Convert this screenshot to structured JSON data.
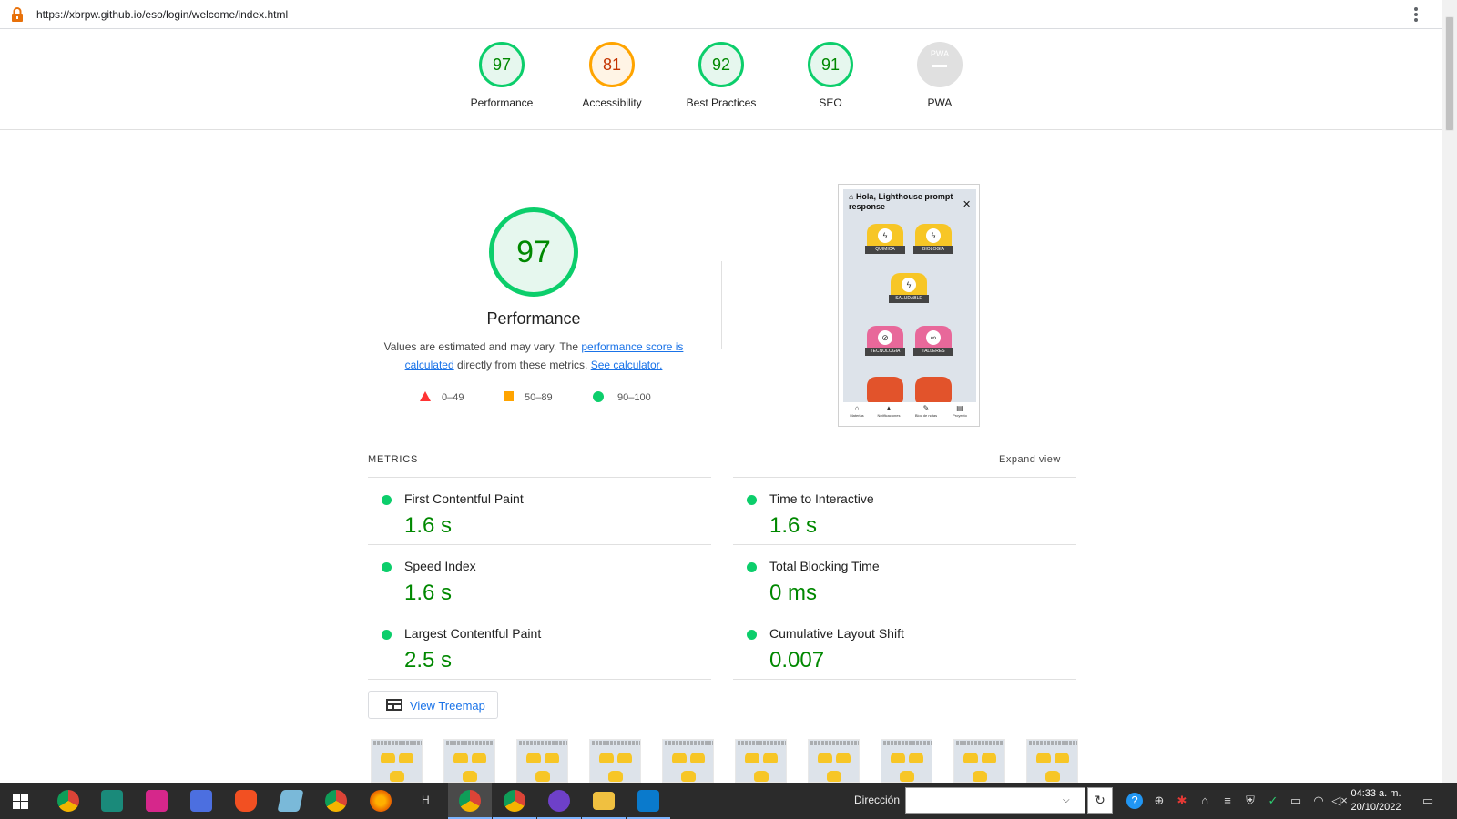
{
  "browser": {
    "url": "https://xbrpw.github.io/eso/login/welcome/index.html"
  },
  "scores": [
    {
      "value": "97",
      "label": "Performance",
      "status": "pass"
    },
    {
      "value": "81",
      "label": "Accessibility",
      "status": "average"
    },
    {
      "value": "92",
      "label": "Best Practices",
      "status": "pass"
    },
    {
      "value": "91",
      "label": "SEO",
      "status": "pass"
    },
    {
      "value": "",
      "label": "PWA",
      "status": "na",
      "badge": "PWA"
    }
  ],
  "performance": {
    "score": "97",
    "title": "Performance",
    "desc_prefix": "Values are estimated and may vary. The ",
    "link1": "performance score is calculated",
    "desc_mid": " directly from these metrics. ",
    "link2": "See calculator.",
    "legend": [
      "0–49",
      "50–89",
      "90–100"
    ]
  },
  "phone_preview": {
    "title": "Hola, Lighthouse prompt response",
    "tiles": [
      "QUIMICA",
      "BIOLOGIA",
      "SALUDABLE",
      "TECNOLOGIA",
      "TALLERES"
    ],
    "nav": [
      "Materias",
      "Notificaciones",
      "Bloc de notas",
      "Proyecto"
    ]
  },
  "metrics": {
    "header": "METRICS",
    "expand": "Expand view",
    "items": [
      {
        "name": "First Contentful Paint",
        "value": "1.6 s"
      },
      {
        "name": "Time to Interactive",
        "value": "1.6 s"
      },
      {
        "name": "Speed Index",
        "value": "1.6 s"
      },
      {
        "name": "Total Blocking Time",
        "value": "0 ms"
      },
      {
        "name": "Largest Contentful Paint",
        "value": "2.5 s"
      },
      {
        "name": "Cumulative Layout Shift",
        "value": "0.007"
      }
    ]
  },
  "treemap_button": "View Treemap",
  "taskbar": {
    "h_label": "H",
    "address_label": "Dirección",
    "time": "04:33 a. m.",
    "date": "20/10/2022"
  },
  "colors": {
    "pass": "#0cce6b",
    "average": "#ffa400",
    "fail": "#ff3333",
    "link": "#1a73e8"
  }
}
